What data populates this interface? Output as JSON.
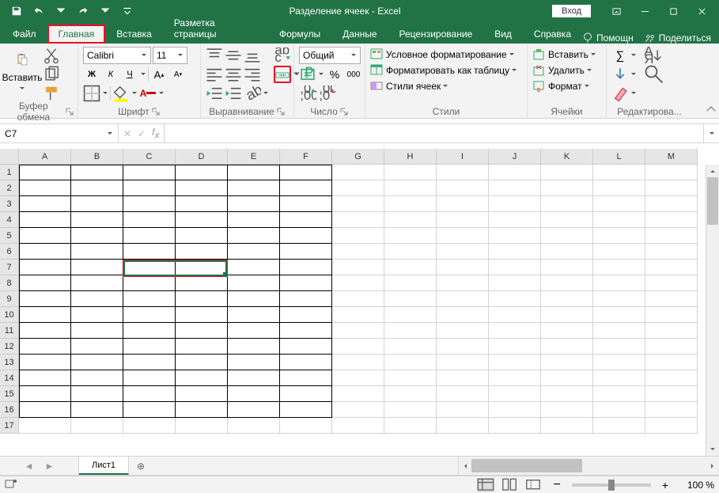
{
  "title": "Разделение ячеек  -  Excel",
  "login": "Вход",
  "tabs": {
    "file": "Файл",
    "home": "Главная",
    "insert": "Вставка",
    "layout": "Разметка страницы",
    "formulas": "Формулы",
    "data": "Данные",
    "review": "Рецензирование",
    "view": "Вид",
    "help": "Справка",
    "assist": "Помощн",
    "share": "Поделиться"
  },
  "ribbon": {
    "clipboard": {
      "label": "Буфер обмена",
      "paste": "Вставить"
    },
    "font": {
      "label": "Шрифт",
      "family": "Calibri",
      "size": "11"
    },
    "align": {
      "label": "Выравнивание"
    },
    "number": {
      "label": "Число",
      "format": "Общий",
      "percent": "%",
      "thousands": "000"
    },
    "styles": {
      "label": "Стили",
      "cond": "Условное форматирование",
      "table": "Форматировать как таблицу",
      "cell": "Стили ячеек"
    },
    "cells": {
      "label": "Ячейки",
      "insert": "Вставить",
      "delete": "Удалить",
      "format": "Формат"
    },
    "editing": {
      "label": "Редактирова..."
    }
  },
  "namebox": "C7",
  "cols": [
    "A",
    "B",
    "C",
    "D",
    "E",
    "F",
    "G",
    "H",
    "I",
    "J",
    "K",
    "L",
    "M"
  ],
  "rows": [
    "1",
    "2",
    "3",
    "4",
    "5",
    "6",
    "7",
    "8",
    "9",
    "10",
    "11",
    "12",
    "13",
    "14",
    "15",
    "16",
    "17"
  ],
  "sheet_tab": "Лист1",
  "zoom": "100 %"
}
